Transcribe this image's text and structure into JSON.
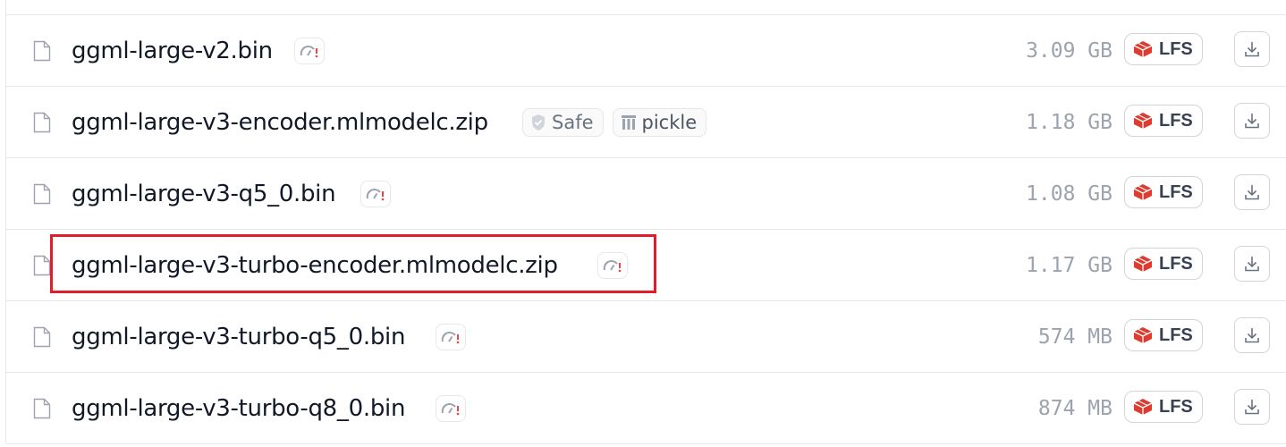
{
  "files": [
    {
      "name": "ggml-large-v2.bin",
      "size": "3.09 GB",
      "lfs": "LFS",
      "badges": [
        "scan"
      ]
    },
    {
      "name": "ggml-large-v3-encoder.mlmodelc.zip",
      "size": "1.18 GB",
      "lfs": "LFS",
      "badges": [
        "safe",
        "pickle"
      ],
      "safe_label": "Safe",
      "pickle_label": "pickle"
    },
    {
      "name": "ggml-large-v3-q5_0.bin",
      "size": "1.08 GB",
      "lfs": "LFS",
      "badges": [
        "scan"
      ]
    },
    {
      "name": "ggml-large-v3-turbo-encoder.mlmodelc.zip",
      "size": "1.17 GB",
      "lfs": "LFS",
      "badges": [
        "scan"
      ],
      "highlighted": true
    },
    {
      "name": "ggml-large-v3-turbo-q5_0.bin",
      "size": "574 MB",
      "lfs": "LFS",
      "badges": [
        "scan"
      ]
    },
    {
      "name": "ggml-large-v3-turbo-q8_0.bin",
      "size": "874 MB",
      "lfs": "LFS",
      "badges": [
        "scan"
      ]
    }
  ],
  "icons": {
    "file": "file-icon",
    "scan": "gauge-warning-icon",
    "safe": "shield-check-icon",
    "pickle": "pickle-columns-icon",
    "lfs": "lfs-brick-icon",
    "download": "download-icon"
  },
  "colors": {
    "highlight": "#e11d2a",
    "lfs_red": "#dc3d2f",
    "warning_red": "#ef4444",
    "size_text": "#9ca3af",
    "border": "#e5e7eb"
  }
}
